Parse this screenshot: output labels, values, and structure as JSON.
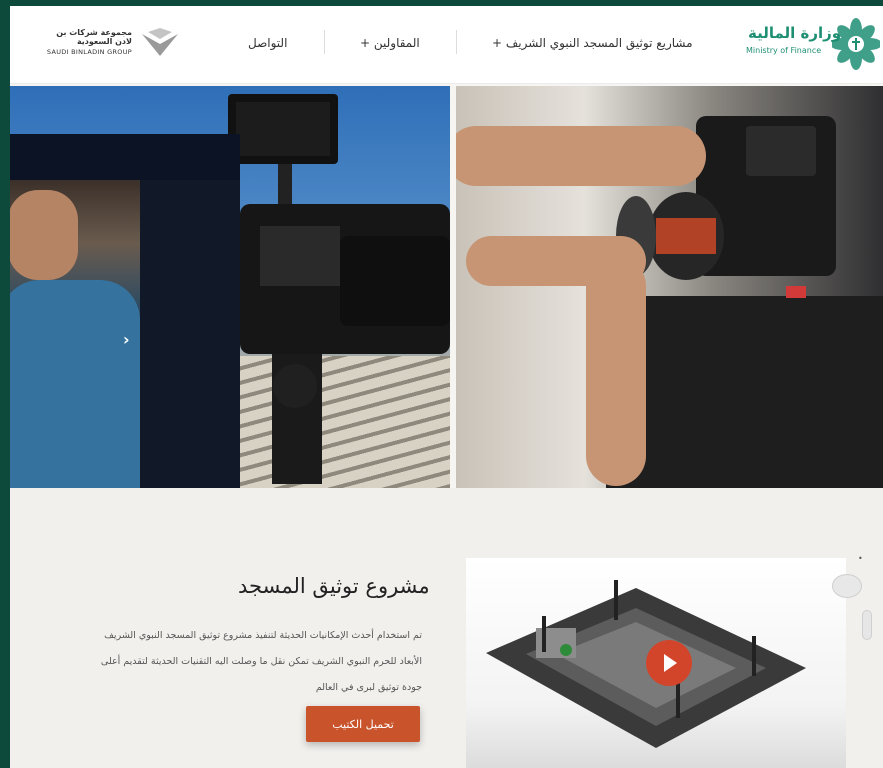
{
  "header": {
    "binladin_logo": {
      "arabic": "مجموعة شركات بن لادن السعودية",
      "english": "SAUDI BINLADIN GROUP",
      "icon": "binladin-logo-icon"
    },
    "nav": {
      "contact": "التواصل",
      "contractors": "+ المقاولين",
      "project": "+ مشاريع توثيق المسجد النبوي الشريف"
    },
    "mof_logo": {
      "arabic": "وزارة المالية",
      "english": "Ministry of Finance",
      "icon": "ministry-emblem-icon"
    }
  },
  "hero": {
    "left_photo": "camera-rig-photo",
    "right_photo": "camera-lens-hands-photo",
    "slider_arrow": "›"
  },
  "content": {
    "title": "مشروع توثيق المسجد",
    "description_lines": [
      "تم استخدام أحدث الإمكانيات الحديثة لتنفيذ مشروع توثيق المسجد النبوي الشريف",
      "الأبعاد للحرم النبوي الشريف تمكن نقل ما وصلت اليه التقنيات الحديثة لتقديم أعلى",
      "جودة توثيق لبرى في العالم"
    ],
    "download_button": "تحميل الكتيب"
  },
  "colors": {
    "brand_green": "#1f8f74",
    "frame": "#0d4a3c",
    "cta": "#c9532b",
    "play": "#d2452b"
  }
}
